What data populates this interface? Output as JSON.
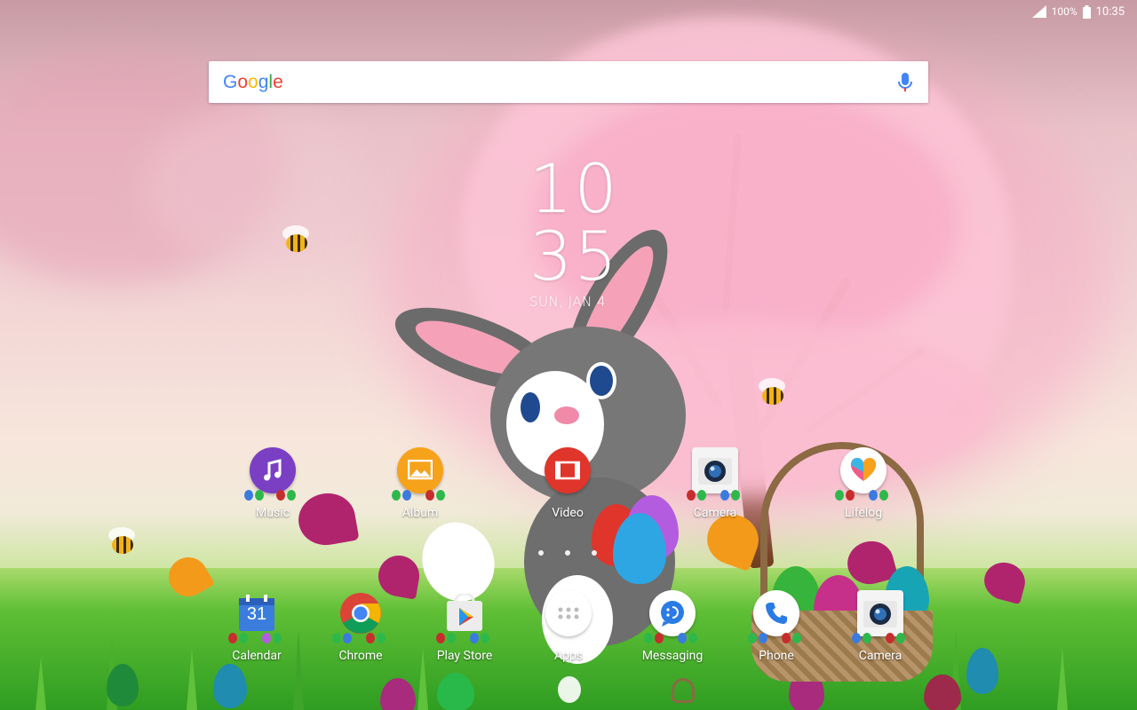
{
  "status_bar": {
    "battery": "100%",
    "time": "10:35"
  },
  "search": {
    "logo": "Google"
  },
  "clock": {
    "hour": "10",
    "minute": "35",
    "date": "SUN, JAN 4"
  },
  "home_apps": [
    {
      "label": "Music"
    },
    {
      "label": "Album"
    },
    {
      "label": "Video"
    },
    {
      "label": "Camera"
    },
    {
      "label": "Lifelog"
    }
  ],
  "dock_apps": [
    {
      "label": "Calendar",
      "badge": "31"
    },
    {
      "label": "Chrome"
    },
    {
      "label": "Play Store"
    },
    {
      "label": "Apps"
    },
    {
      "label": "Messaging"
    },
    {
      "label": "Phone"
    },
    {
      "label": "Camera"
    }
  ],
  "colors": {
    "music": "#7b3fc4",
    "album": "#f7a21b",
    "video": "#e0352b",
    "calendar": "#3b7ddd",
    "messaging": "#2a7be4"
  }
}
